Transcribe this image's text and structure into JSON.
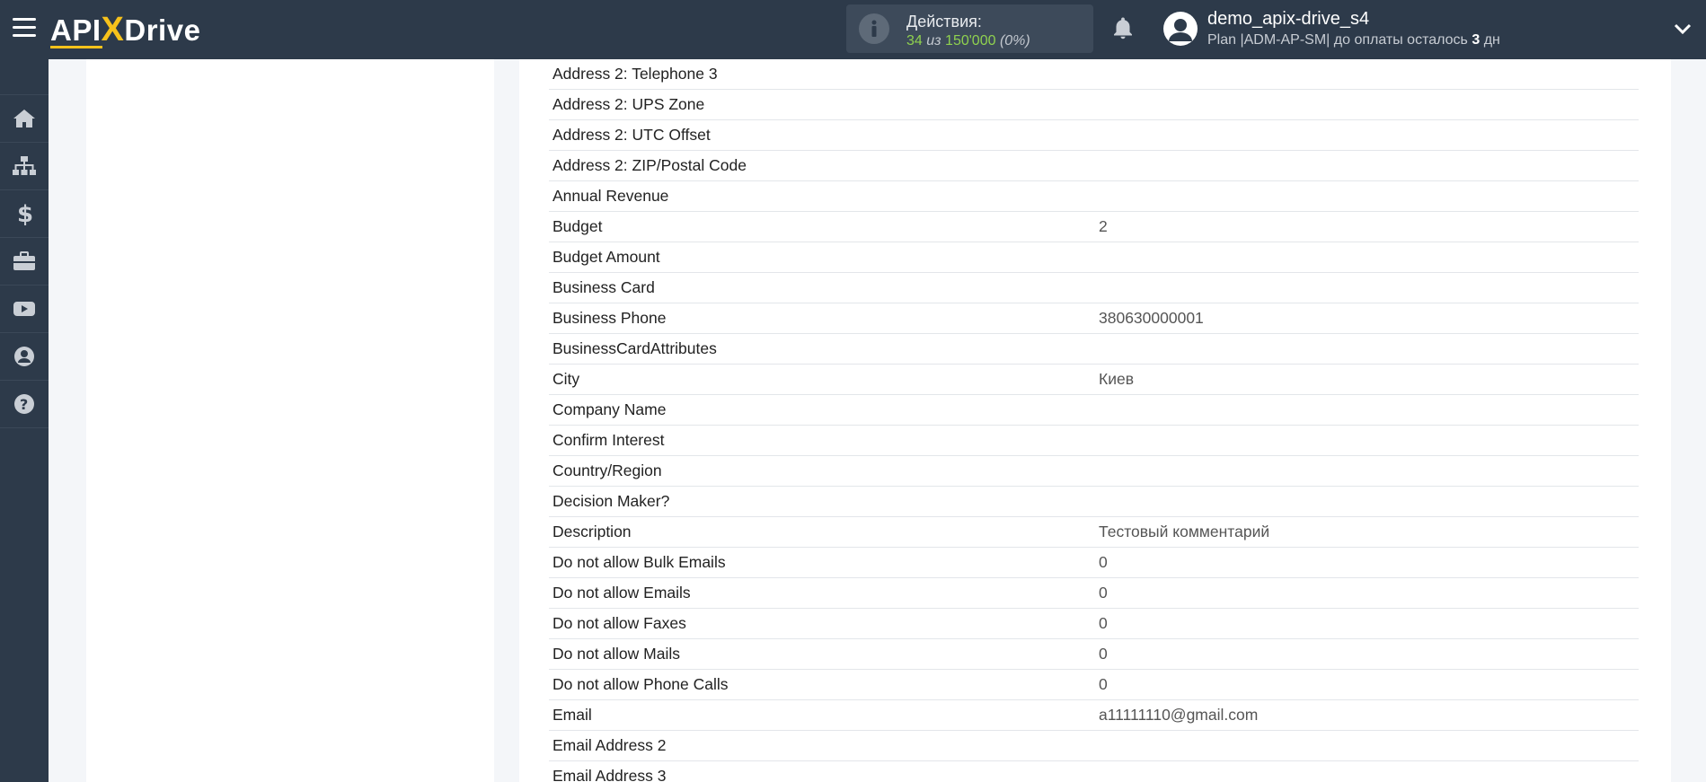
{
  "topbar": {
    "logo": {
      "part1": "API",
      "x": "X",
      "part2": "Drive"
    },
    "actions": {
      "label": "Действия:",
      "used": "34",
      "of": "из",
      "total": "150'000",
      "percent": "(0%)"
    },
    "user": {
      "name": "demo_apix-drive_s4",
      "plan_prefix": "Plan |ADM-AP-SM| до оплаты осталось",
      "days": "3",
      "days_unit": "дн"
    }
  },
  "sidebar": {
    "items": [
      {
        "icon": "home-icon"
      },
      {
        "icon": "sitemap-icon"
      },
      {
        "icon": "dollar-icon"
      },
      {
        "icon": "briefcase-icon"
      },
      {
        "icon": "youtube-icon"
      },
      {
        "icon": "user-circle-icon"
      },
      {
        "icon": "question-icon"
      }
    ]
  },
  "fields": [
    {
      "key": "Address 2: Telephone 3",
      "value": ""
    },
    {
      "key": "Address 2: UPS Zone",
      "value": ""
    },
    {
      "key": "Address 2: UTC Offset",
      "value": ""
    },
    {
      "key": "Address 2: ZIP/Postal Code",
      "value": ""
    },
    {
      "key": "Annual Revenue",
      "value": ""
    },
    {
      "key": "Budget",
      "value": "2"
    },
    {
      "key": "Budget Amount",
      "value": ""
    },
    {
      "key": "Business Card",
      "value": ""
    },
    {
      "key": "Business Phone",
      "value": "380630000001"
    },
    {
      "key": "BusinessCardAttributes",
      "value": ""
    },
    {
      "key": "City",
      "value": "Киев"
    },
    {
      "key": "Company Name",
      "value": ""
    },
    {
      "key": "Confirm Interest",
      "value": ""
    },
    {
      "key": "Country/Region",
      "value": ""
    },
    {
      "key": "Decision Maker?",
      "value": ""
    },
    {
      "key": "Description",
      "value": "Тестовый комментарий"
    },
    {
      "key": "Do not allow Bulk Emails",
      "value": "0"
    },
    {
      "key": "Do not allow Emails",
      "value": "0"
    },
    {
      "key": "Do not allow Faxes",
      "value": "0"
    },
    {
      "key": "Do not allow Mails",
      "value": "0"
    },
    {
      "key": "Do not allow Phone Calls",
      "value": "0"
    },
    {
      "key": "Email",
      "value": "a11111110@gmail.com"
    },
    {
      "key": "Email Address 2",
      "value": ""
    },
    {
      "key": "Email Address 3",
      "value": ""
    }
  ]
}
